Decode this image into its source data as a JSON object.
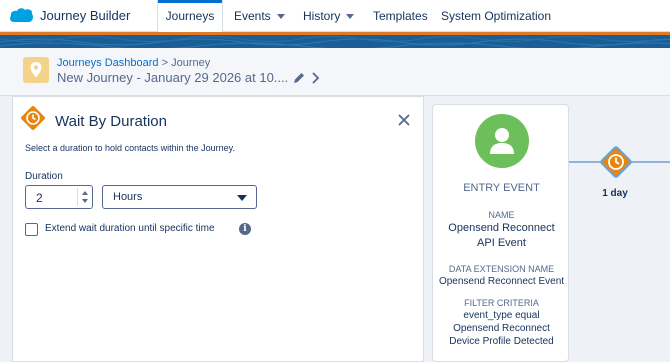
{
  "app": {
    "name": "Journey Builder"
  },
  "nav": {
    "tabs": [
      {
        "label": "Journeys",
        "active": true,
        "dropdown": false
      },
      {
        "label": "Events",
        "active": false,
        "dropdown": true
      },
      {
        "label": "History",
        "active": false,
        "dropdown": true
      },
      {
        "label": "Templates",
        "active": false,
        "dropdown": false
      },
      {
        "label": "System Optimization",
        "active": false,
        "dropdown": false
      }
    ]
  },
  "header": {
    "breadcrumb_link": "Journeys Dashboard",
    "breadcrumb_sep": ">",
    "breadcrumb_current": "Journey",
    "title": "New Journey - January 29 2026 at 10...."
  },
  "panel": {
    "title": "Wait By Duration",
    "description": "Select a duration to hold contacts within the Journey.",
    "duration_label": "Duration",
    "duration_value": "2",
    "unit_value": "Hours",
    "extend_label": "Extend wait duration until specific time",
    "extend_checked": false,
    "info_glyph": "i"
  },
  "entry_card": {
    "title": "ENTRY EVENT",
    "name_label": "NAME",
    "name_value": "Opensend Reconnect API Event",
    "de_label": "DATA EXTENSION NAME",
    "de_value": "Opensend Reconnect Event",
    "filter_label": "FILTER CRITERIA",
    "filter_value": "event_type equal Opensend Reconnect Device Profile Detected"
  },
  "canvas": {
    "wait_node_label": "1 day"
  },
  "colors": {
    "accent_blue": "#0070d2",
    "wait_orange": "#e8850e",
    "entry_green": "#6cbf5a",
    "band_blue": "#1b5e96",
    "band_orange": "#e07b25"
  },
  "icons": {
    "brand": "salesforce-cloud-icon",
    "journey": "map-pin-icon",
    "edit": "pencil-icon",
    "expand": "chevron-right-icon",
    "wait": "clock-icon",
    "close": "close-icon",
    "entry": "person-icon",
    "info": "info-icon"
  }
}
